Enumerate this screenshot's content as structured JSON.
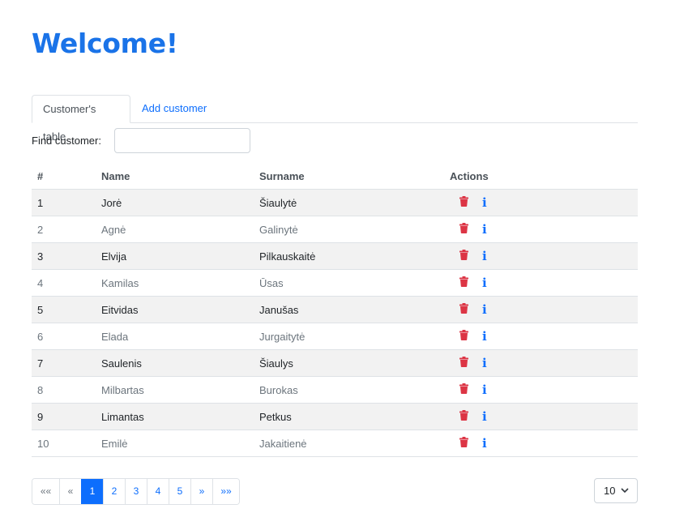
{
  "page": {
    "title": "Welcome!"
  },
  "tabs": [
    {
      "label": "Customer's table",
      "active": true
    },
    {
      "label": "Add customer",
      "active": false
    }
  ],
  "search": {
    "label": "Find customer:",
    "value": "",
    "placeholder": ""
  },
  "table": {
    "headers": [
      "#",
      "Name",
      "Surname",
      "Actions"
    ],
    "rows": [
      {
        "id": "1",
        "name": "Jorė",
        "surname": "Šiaulytė"
      },
      {
        "id": "2",
        "name": "Agnė",
        "surname": "Galinytė"
      },
      {
        "id": "3",
        "name": "Elvija",
        "surname": "Pilkauskaitė"
      },
      {
        "id": "4",
        "name": "Kamilas",
        "surname": "Ūsas"
      },
      {
        "id": "5",
        "name": "Eitvidas",
        "surname": "Janušas"
      },
      {
        "id": "6",
        "name": "Elada",
        "surname": "Jurgaitytė"
      },
      {
        "id": "7",
        "name": "Saulenis",
        "surname": "Šiaulys"
      },
      {
        "id": "8",
        "name": "Milbartas",
        "surname": "Burokas"
      },
      {
        "id": "9",
        "name": "Limantas",
        "surname": "Petkus"
      },
      {
        "id": "10",
        "name": "Emilė",
        "surname": "Jakaitienė"
      }
    ],
    "actions": {
      "delete_icon": "trash-icon",
      "info_icon": "info-icon",
      "info_glyph": "i"
    }
  },
  "pagination": {
    "first": "««",
    "prev": "«",
    "pages": [
      "1",
      "2",
      "3",
      "4",
      "5"
    ],
    "current": "1",
    "next": "»",
    "last": "»»",
    "page_size": "10"
  },
  "colors": {
    "title": "#1a73e8",
    "link": "#0d6efd",
    "delete": "#dc3545",
    "active_page": "#0d6efd",
    "striped_row": "#f2f2f2"
  }
}
